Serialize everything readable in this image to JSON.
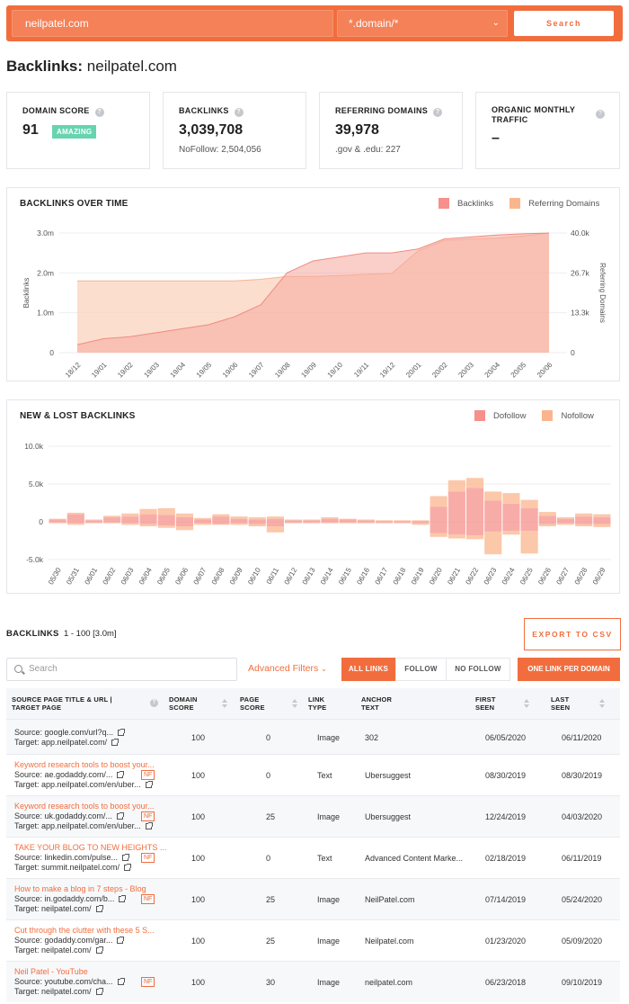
{
  "search": {
    "domain_value": "neilpatel.com",
    "scope_value": "*.domain/*",
    "search_label": "Search"
  },
  "page": {
    "title_prefix": "Backlinks:",
    "title_domain": "neilpatel.com"
  },
  "cards": {
    "domain_score": {
      "label": "DOMAIN SCORE",
      "value": "91",
      "badge": "AMAZING"
    },
    "backlinks": {
      "label": "BACKLINKS",
      "value": "3,039,708",
      "sub": "NoFollow: 2,504,056"
    },
    "referring_domains": {
      "label": "REFERRING DOMAINS",
      "value": "39,978",
      "sub": ".gov & .edu: 227"
    },
    "organic_traffic": {
      "label_line1": "ORGANIC MONTHLY",
      "label_line2": "TRAFFIC",
      "value": "–"
    }
  },
  "colors": {
    "accent": "#f26d3d",
    "backlinks_fill": "#f7c2b8",
    "backlinks_line": "#f08c80",
    "domains_fill": "#fbd3be",
    "dofollow": "#f5908b",
    "nofollow": "#fbb58e"
  },
  "chart_data": [
    {
      "type": "area",
      "title": "BACKLINKS OVER TIME",
      "ylabel": "Backlinks",
      "y2label": "Referring Domains",
      "ylim": [
        0,
        3000000
      ],
      "y2lim": [
        0,
        40000
      ],
      "yticks": [
        "0",
        "1.0m",
        "2.0m",
        "3.0m"
      ],
      "y2ticks": [
        "0",
        "13.3k",
        "26.7k",
        "40.0k"
      ],
      "categories": [
        "18/12",
        "19/01",
        "19/02",
        "19/03",
        "19/04",
        "19/05",
        "19/06",
        "19/07",
        "19/08",
        "19/09",
        "19/10",
        "19/11",
        "19/12",
        "20/01",
        "20/02",
        "20/03",
        "20/04",
        "20/05",
        "20/06"
      ],
      "legend_position": "top-right",
      "series": [
        {
          "name": "Backlinks",
          "axis": "left",
          "values": [
            200000,
            350000,
            400000,
            500000,
            600000,
            700000,
            900000,
            1200000,
            2000000,
            2300000,
            2400000,
            2500000,
            2500000,
            2600000,
            2850000,
            2900000,
            2950000,
            2980000,
            3000000
          ]
        },
        {
          "name": "Referring Domains",
          "axis": "right",
          "values": [
            24000,
            24000,
            24000,
            24000,
            24000,
            24000,
            24000,
            24500,
            25500,
            25500,
            25800,
            26200,
            26500,
            34000,
            37500,
            38000,
            38300,
            39000,
            40000
          ]
        }
      ]
    },
    {
      "type": "bar",
      "title": "NEW & LOST BACKLINKS",
      "ylim": [
        -5000,
        10000
      ],
      "yticks": [
        "-5.0k",
        "0",
        "5.0k",
        "10.0k"
      ],
      "legend_position": "top-right",
      "categories": [
        "05/30",
        "05/31",
        "06/01",
        "06/02",
        "06/03",
        "06/04",
        "06/05",
        "06/06",
        "06/07",
        "06/08",
        "06/09",
        "06/10",
        "06/11",
        "06/12",
        "06/13",
        "06/14",
        "06/15",
        "06/16",
        "06/17",
        "06/18",
        "06/19",
        "06/20",
        "06/21",
        "06/22",
        "06/23",
        "06/24",
        "06/25",
        "06/26",
        "06/27",
        "06/28",
        "06/29"
      ],
      "series": [
        {
          "name": "Dofollow",
          "new": [
            300,
            1000,
            200,
            600,
            700,
            1000,
            900,
            600,
            300,
            700,
            400,
            300,
            400,
            200,
            200,
            400,
            300,
            200,
            100,
            100,
            100,
            2000,
            4000,
            4500,
            2800,
            2400,
            1800,
            800,
            400,
            700,
            600
          ],
          "lost": [
            -100,
            -200,
            -100,
            -100,
            -200,
            -300,
            -500,
            -600,
            -200,
            -300,
            -200,
            -300,
            -600,
            -100,
            -100,
            -100,
            -100,
            -100,
            -100,
            -100,
            -200,
            -1500,
            -1700,
            -1800,
            -1300,
            -1200,
            -1200,
            -300,
            -200,
            -300,
            -300
          ]
        },
        {
          "name": "Nofollow",
          "new": [
            100,
            200,
            100,
            200,
            400,
            700,
            900,
            500,
            200,
            300,
            300,
            300,
            300,
            100,
            100,
            200,
            100,
            100,
            100,
            100,
            100,
            1400,
            1500,
            1300,
            1200,
            1400,
            1100,
            500,
            200,
            400,
            400
          ],
          "lost": [
            -100,
            -200,
            -100,
            -100,
            -200,
            -300,
            -300,
            -500,
            -200,
            -100,
            -200,
            -300,
            -800,
            -100,
            -100,
            -100,
            -100,
            -100,
            -100,
            -100,
            -200,
            -500,
            -500,
            -500,
            -3000,
            -500,
            -3000,
            -300,
            -200,
            -300,
            -400
          ]
        }
      ]
    }
  ],
  "backlinks_section": {
    "label": "BACKLINKS",
    "range": "1 - 100 [3.0m]",
    "export_label": "EXPORT TO CSV",
    "search_placeholder": "Search",
    "advanced_filters": "Advanced Filters",
    "filter_all": "ALL LINKS",
    "filter_follow": "FOLLOW",
    "filter_nofollow": "NO FOLLOW",
    "one_link": "ONE LINK PER DOMAIN"
  },
  "table": {
    "headers": {
      "source": "SOURCE PAGE TITLE & URL | TARGET PAGE",
      "domain_score": "DOMAIN SCORE",
      "page_score": "PAGE SCORE",
      "link_type": "LINK TYPE",
      "anchor": "ANCHOR TEXT",
      "first_seen": "FIRST SEEN",
      "last_seen": "LAST SEEN"
    },
    "rows": [
      {
        "title": "",
        "source": "Source: google.com/url?q...",
        "target": "Target: app.neilpatel.com/",
        "nf": "",
        "domain_score": "100",
        "page_score": "0",
        "link_type": "Image",
        "anchor": "302",
        "first_seen": "06/05/2020",
        "last_seen": "06/11/2020"
      },
      {
        "title": "Keyword research tools to boost your...",
        "source": "Source: ae.godaddy.com/...",
        "target": "Target: app.neilpatel.com/en/uber...",
        "nf": "NF",
        "domain_score": "100",
        "page_score": "0",
        "link_type": "Text",
        "anchor": "Ubersuggest",
        "first_seen": "08/30/2019",
        "last_seen": "08/30/2019"
      },
      {
        "title": "Keyword research tools to boost your...",
        "source": "Source: uk.godaddy.com/...",
        "target": "Target: app.neilpatel.com/en/uber...",
        "nf": "NF",
        "domain_score": "100",
        "page_score": "25",
        "link_type": "Image",
        "anchor": "Ubersuggest",
        "first_seen": "12/24/2019",
        "last_seen": "04/03/2020"
      },
      {
        "title": "TAKE YOUR BLOG TO NEW HEIGHTS ...",
        "source": "Source: linkedin.com/pulse...",
        "target": "Target: summit.neilpatel.com/",
        "nf": "NF",
        "domain_score": "100",
        "page_score": "0",
        "link_type": "Text",
        "anchor": "Advanced Content Marke...",
        "first_seen": "02/18/2019",
        "last_seen": "06/11/2019"
      },
      {
        "title": "How to make a blog in 7 steps - Blog",
        "source": "Source: in.godaddy.com/b...",
        "target": "Target: neilpatel.com/",
        "nf": "NF",
        "domain_score": "100",
        "page_score": "25",
        "link_type": "Image",
        "anchor": "NeilPatel.com",
        "first_seen": "07/14/2019",
        "last_seen": "05/24/2020"
      },
      {
        "title": "Cut through the clutter with these 5 S...",
        "source": "Source: godaddy.com/gar...",
        "target": "Target: neilpatel.com/",
        "nf": "",
        "domain_score": "100",
        "page_score": "25",
        "link_type": "Image",
        "anchor": "Neilpatel.com",
        "first_seen": "01/23/2020",
        "last_seen": "05/09/2020"
      },
      {
        "title": "Neil Patel - YouTube",
        "source": "Source: youtube.com/cha...",
        "target": "Target: neilpatel.com/",
        "nf": "NF",
        "domain_score": "100",
        "page_score": "30",
        "link_type": "Image",
        "anchor": "neilpatel.com",
        "first_seen": "06/23/2018",
        "last_seen": "09/10/2019"
      }
    ]
  }
}
